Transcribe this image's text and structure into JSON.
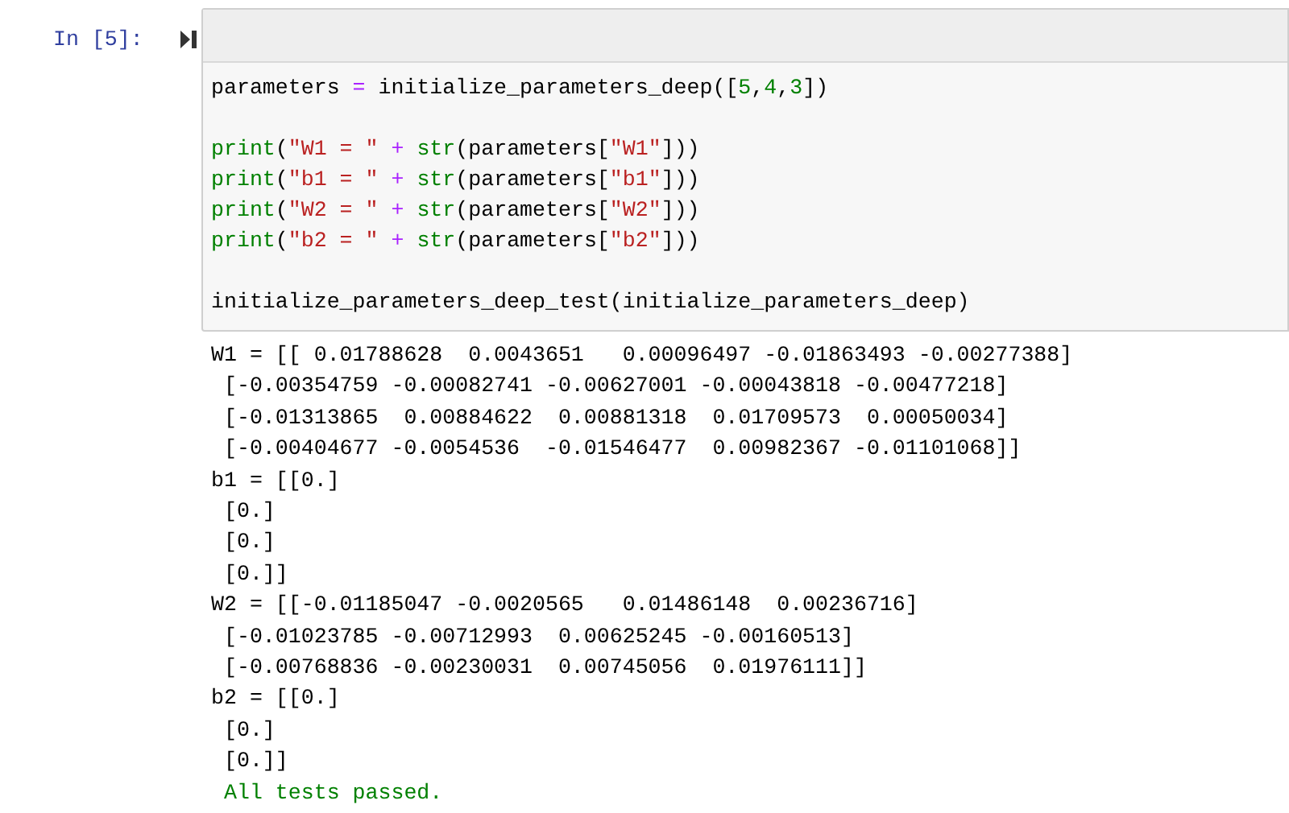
{
  "cell": {
    "prompt": "In [5]:",
    "code_blocks": [
      [
        [
          {
            "kind": "name",
            "text": "parameters "
          },
          {
            "kind": "operator",
            "text": "="
          },
          {
            "kind": "name",
            "text": " initialize_parameters_deep(["
          },
          {
            "kind": "number",
            "text": "5"
          },
          {
            "kind": "name",
            "text": ","
          },
          {
            "kind": "number",
            "text": "4"
          },
          {
            "kind": "name",
            "text": ","
          },
          {
            "kind": "number",
            "text": "3"
          },
          {
            "kind": "name",
            "text": "])"
          }
        ]
      ],
      [
        [
          {
            "kind": "builtin",
            "text": "print"
          },
          {
            "kind": "name",
            "text": "("
          },
          {
            "kind": "string",
            "text": "\"W1 = \""
          },
          {
            "kind": "operator",
            "text": " + "
          },
          {
            "kind": "builtin",
            "text": "str"
          },
          {
            "kind": "name",
            "text": "(parameters["
          },
          {
            "kind": "string",
            "text": "\"W1\""
          },
          {
            "kind": "name",
            "text": "]))"
          }
        ],
        [
          {
            "kind": "builtin",
            "text": "print"
          },
          {
            "kind": "name",
            "text": "("
          },
          {
            "kind": "string",
            "text": "\"b1 = \""
          },
          {
            "kind": "operator",
            "text": " + "
          },
          {
            "kind": "builtin",
            "text": "str"
          },
          {
            "kind": "name",
            "text": "(parameters["
          },
          {
            "kind": "string",
            "text": "\"b1\""
          },
          {
            "kind": "name",
            "text": "]))"
          }
        ],
        [
          {
            "kind": "builtin",
            "text": "print"
          },
          {
            "kind": "name",
            "text": "("
          },
          {
            "kind": "string",
            "text": "\"W2 = \""
          },
          {
            "kind": "operator",
            "text": " + "
          },
          {
            "kind": "builtin",
            "text": "str"
          },
          {
            "kind": "name",
            "text": "(parameters["
          },
          {
            "kind": "string",
            "text": "\"W2\""
          },
          {
            "kind": "name",
            "text": "]))"
          }
        ],
        [
          {
            "kind": "builtin",
            "text": "print"
          },
          {
            "kind": "name",
            "text": "("
          },
          {
            "kind": "string",
            "text": "\"b2 = \""
          },
          {
            "kind": "operator",
            "text": " + "
          },
          {
            "kind": "builtin",
            "text": "str"
          },
          {
            "kind": "name",
            "text": "(parameters["
          },
          {
            "kind": "string",
            "text": "\"b2\""
          },
          {
            "kind": "name",
            "text": "]))"
          }
        ]
      ],
      [
        [
          {
            "kind": "name",
            "text": "initialize_parameters_deep_test(initialize_parameters_deep)"
          }
        ]
      ]
    ],
    "output_lines": [
      "W1 = [[ 0.01788628  0.0043651   0.00096497 -0.01863493 -0.00277388]",
      " [-0.00354759 -0.00082741 -0.00627001 -0.00043818 -0.00477218]",
      " [-0.01313865  0.00884622  0.00881318  0.01709573  0.00050034]",
      " [-0.00404677 -0.0054536  -0.01546477  0.00982367 -0.01101068]]",
      "b1 = [[0.]",
      " [0.]",
      " [0.]",
      " [0.]]",
      "W2 = [[-0.01185047 -0.0020565   0.01486148  0.00236716]",
      " [-0.01023785 -0.00712993  0.00625245 -0.00160513]",
      " [-0.00768836 -0.00230031  0.00745056  0.01976111]]",
      "b2 = [[0.]",
      " [0.]",
      " [0.]]"
    ],
    "success_message": " All tests passed."
  }
}
